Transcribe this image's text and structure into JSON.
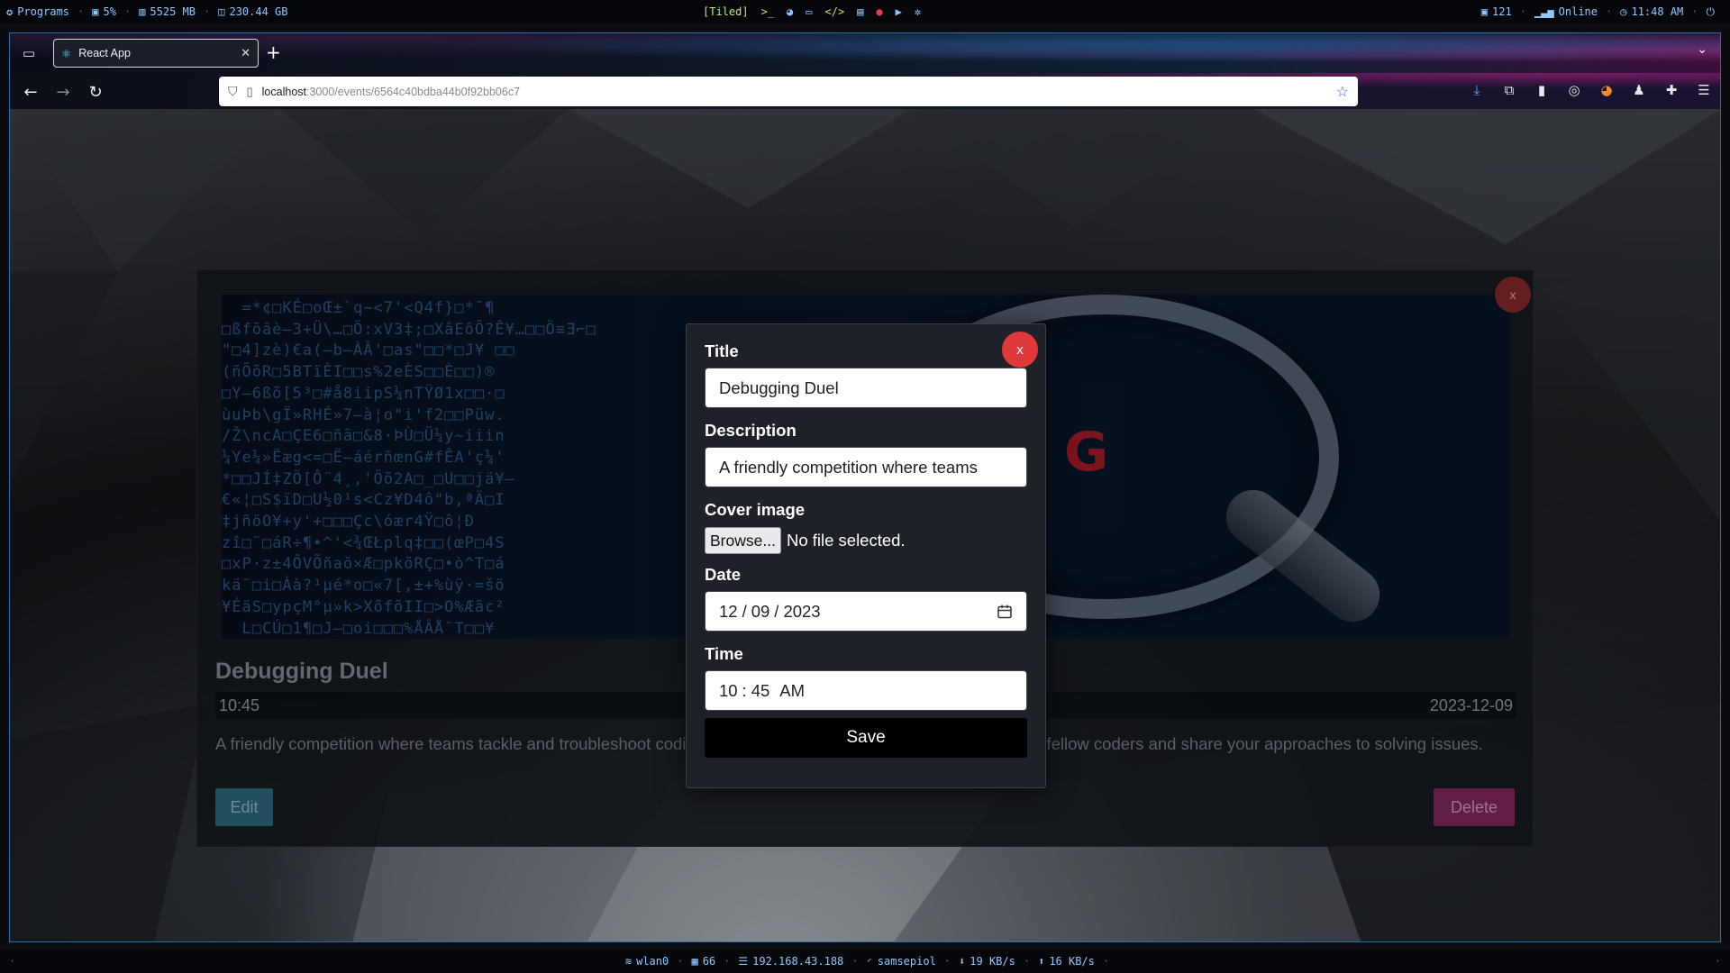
{
  "system_bar": {
    "programs": "Programs",
    "cpu": "5%",
    "ram": "5525 MB",
    "disk": "230.44 GB",
    "workspace_mode": "[Tiled]",
    "updates": "121",
    "network_status": "Online",
    "clock": "11:48 AM"
  },
  "browser": {
    "tab_title": "React App",
    "url_host": "localhost",
    "url_path": ":3000/events/6564c40bdba44b0f92bb06c7"
  },
  "event": {
    "title": "Debugging Duel",
    "time": "10:45",
    "date": "2023-12-09",
    "description": "A friendly competition where teams tackle and troubleshoot coding challenges. Put your debugging skills against fellow coders and share your approaches to solving issues.",
    "edit_label": "Edit",
    "delete_label": "Delete",
    "close_label": "x"
  },
  "modal": {
    "close_label": "x",
    "title_label": "Title",
    "title_value": "Debugging Duel",
    "description_label": "Description",
    "description_value": "A friendly competition where teams",
    "cover_label": "Cover image",
    "browse_label": "Browse...",
    "file_status": "No file selected.",
    "date_label": "Date",
    "date_month": "12",
    "date_day": "09",
    "date_year": "2023",
    "time_label": "Time",
    "time_hour": "10",
    "time_minute": "45",
    "time_period": "AM",
    "save_label": "Save"
  },
  "status_bar": {
    "interface": "wlan0",
    "signal": "66",
    "ip": "192.168.43.188",
    "ssid": "samsepiol",
    "down": "19 KB/s",
    "up": "16 KB/s"
  },
  "colors": {
    "accent": "#8ec9ff",
    "modal_close": "#e0383b",
    "edit": "#2f6c80",
    "delete": "#8a2a62"
  }
}
